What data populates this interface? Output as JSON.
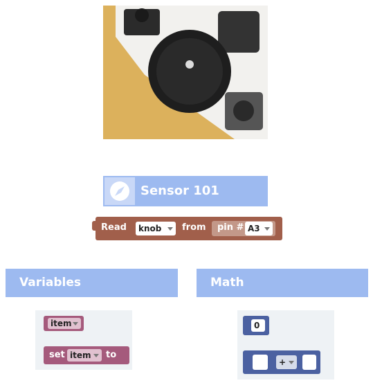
{
  "sensor_category": {
    "title": "Sensor 101",
    "icon": "compass-icon"
  },
  "read_block": {
    "read_label": "Read",
    "sensor_value": "knob",
    "from_label": "from",
    "pin_label": "pin #",
    "pin_value": "A3",
    "color": "#a15f4b"
  },
  "variables_category": {
    "title": "Variables",
    "get_block": {
      "var": "item"
    },
    "set_block": {
      "set_label": "set",
      "var": "item",
      "to_label": "to"
    },
    "color": "#a55a7c"
  },
  "math_category": {
    "title": "Math",
    "number_block": {
      "value": "0"
    },
    "arithmetic_block": {
      "operator": "+"
    },
    "color": "#4b61a1"
  },
  "colors": {
    "header": "#9dbaf0",
    "panel": "#eef2f5"
  }
}
